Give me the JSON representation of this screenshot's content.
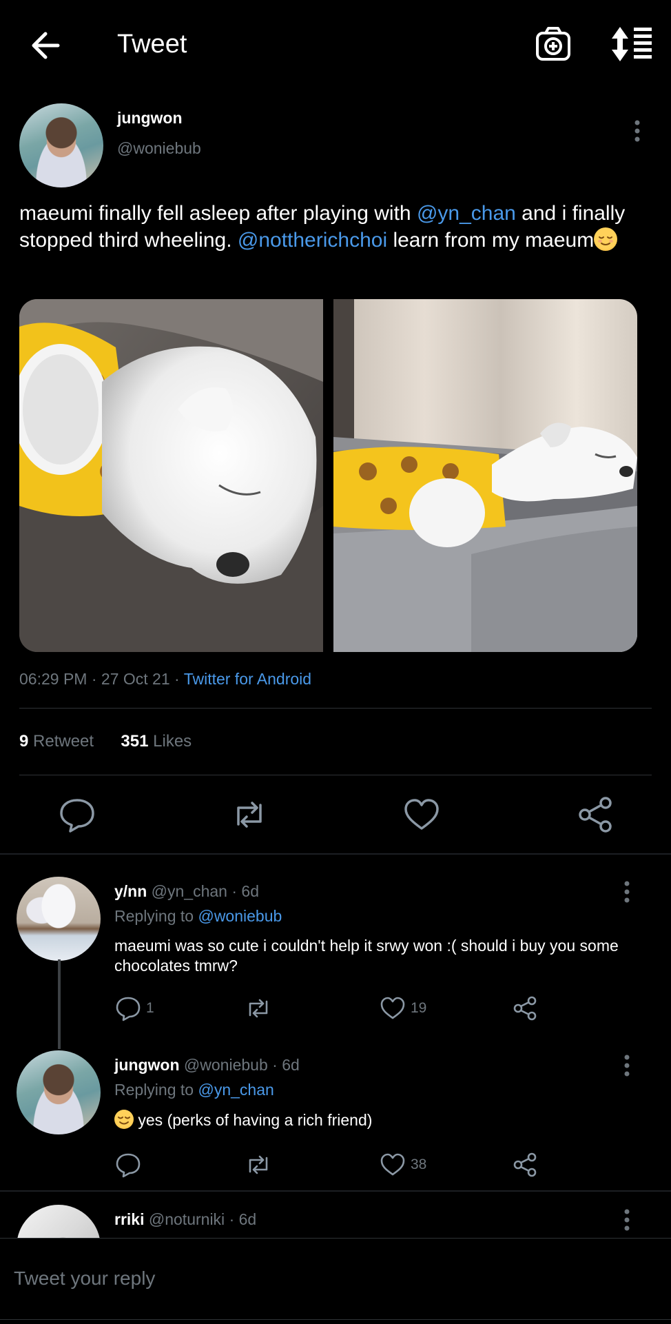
{
  "header": {
    "title": "Tweet",
    "back_icon": "arrow-left-icon",
    "camera_icon": "camera-plus-icon",
    "sort_icon": "sort-list-icon"
  },
  "tweet": {
    "author": {
      "name": "jungwon",
      "handle": "@woniebub"
    },
    "text": {
      "part1": "maeumi finally fell asleep after playing with ",
      "mention1": "@yn_chan",
      "part2": " and i finally stopped third wheeling. ",
      "mention2": "@nottherichchoi",
      "part3": " learn from my maeum",
      "emoji": "relieved-face-emoji"
    },
    "time": "06:29 PM",
    "date": "27 Oct 21",
    "separator": "·",
    "source": "Twitter for Android",
    "retweets_count": "9",
    "retweets_label": "Retweet",
    "likes_count": "351",
    "likes_label": "Likes"
  },
  "replies": [
    {
      "name": "y/nn",
      "handle": "@yn_chan",
      "age": "· 6d",
      "replying_label": "Replying to ",
      "replying_to": "@woniebub",
      "text": "maeumi was so cute i couldn't help it srwy won :( should i buy you some chocolates tmrw?",
      "reply_count": "1",
      "like_count": "19"
    },
    {
      "name": "jungwon",
      "handle": "@woniebub",
      "age": "· 6d",
      "replying_label": "Replying to ",
      "replying_to": "@yn_chan",
      "text": "yes (perks of having a rich friend)",
      "reply_count": "",
      "like_count": "38"
    },
    {
      "name": "rriki",
      "handle": "@noturniki",
      "age": "· 6d"
    }
  ],
  "compose": {
    "placeholder": "Tweet your reply"
  },
  "colors": {
    "background": "#000000",
    "link": "#4a99e9",
    "muted": "#6e767d",
    "divider": "#2f3336"
  }
}
